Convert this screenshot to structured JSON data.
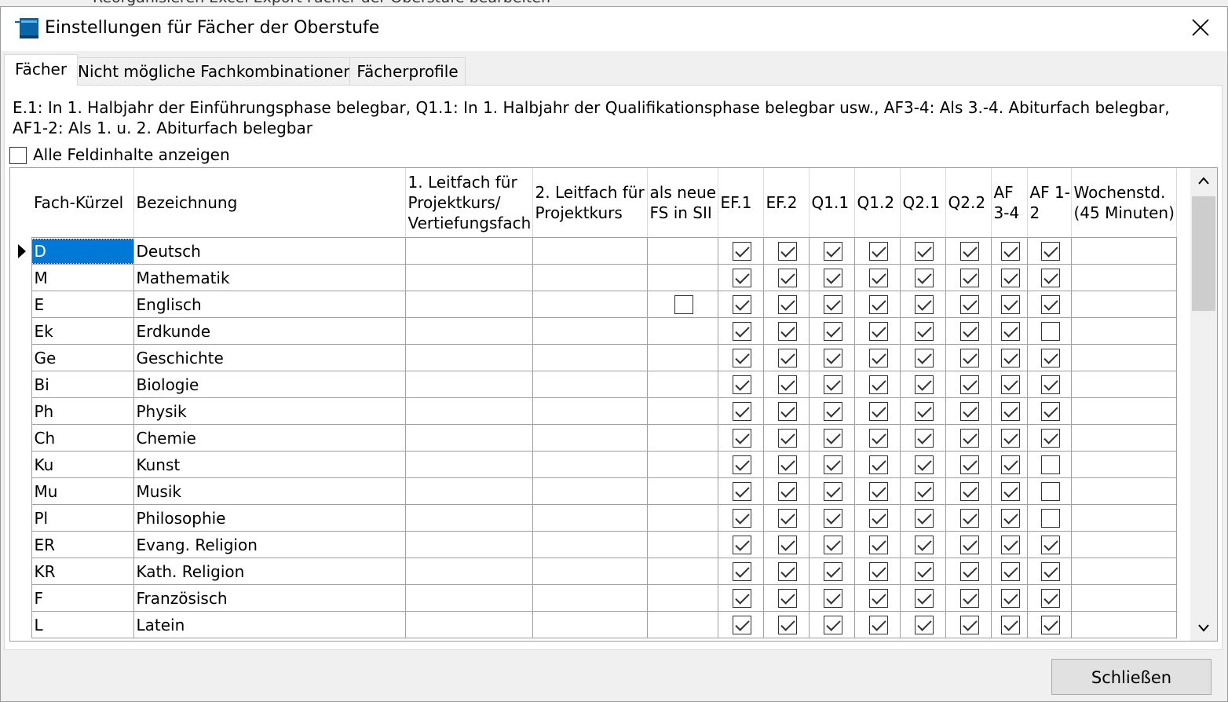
{
  "background_window": {
    "title_fragment": "Reorganisieren   Excel Export   Fächer der Oberstufe bearbeiten"
  },
  "window": {
    "title": "Einstellungen für Fächer der Oberstufe"
  },
  "tabs": [
    {
      "label": "Fächer",
      "active": true
    },
    {
      "label": "Nicht mögliche Fachkombinationen",
      "active": false
    },
    {
      "label": "Fächerprofile",
      "active": false
    }
  ],
  "description": "E.1: In 1. Halbjahr der Einführungsphase belegbar, Q1.1: In 1. Halbjahr der Qualifikationsphase belegbar usw., AF3-4: Als 3.-4. Abiturfach belegbar, AF1-2: Als 1. u. 2. Abiturfach belegbar",
  "show_all_checkbox": {
    "label": "Alle Feldinhalte anzeigen",
    "checked": false
  },
  "columns": {
    "kuerzel": "Fach-Kürzel",
    "bezeichnung": "Bezeichnung",
    "leitfach1": "1. Leitfach für Projektkurs/ Vertiefungsfach",
    "leitfach2": "2. Leitfach für Projektkurs",
    "neue_fs": "als neue FS in SII",
    "ef1": "EF.1",
    "ef2": "EF.2",
    "q11": "Q1.1",
    "q12": "Q1.2",
    "q21": "Q2.1",
    "q22": "Q2.2",
    "af34": "AF 3-4",
    "af12": "AF 1-2",
    "wochenstd": "Wochenstd. (45 Minuten)"
  },
  "rows": [
    {
      "kuerzel": "D",
      "bezeichnung": "Deutsch",
      "neue_fs": null,
      "ef1": true,
      "ef2": true,
      "q11": true,
      "q12": true,
      "q21": true,
      "q22": true,
      "af34": true,
      "af12": true,
      "selected": true
    },
    {
      "kuerzel": "M",
      "bezeichnung": "Mathematik",
      "neue_fs": null,
      "ef1": true,
      "ef2": true,
      "q11": true,
      "q12": true,
      "q21": true,
      "q22": true,
      "af34": true,
      "af12": true
    },
    {
      "kuerzel": "E",
      "bezeichnung": "Englisch",
      "neue_fs": false,
      "ef1": true,
      "ef2": true,
      "q11": true,
      "q12": true,
      "q21": true,
      "q22": true,
      "af34": true,
      "af12": true
    },
    {
      "kuerzel": "Ek",
      "bezeichnung": "Erdkunde",
      "neue_fs": null,
      "ef1": true,
      "ef2": true,
      "q11": true,
      "q12": true,
      "q21": true,
      "q22": true,
      "af34": true,
      "af12": false
    },
    {
      "kuerzel": "Ge",
      "bezeichnung": "Geschichte",
      "neue_fs": null,
      "ef1": true,
      "ef2": true,
      "q11": true,
      "q12": true,
      "q21": true,
      "q22": true,
      "af34": true,
      "af12": true
    },
    {
      "kuerzel": "Bi",
      "bezeichnung": "Biologie",
      "neue_fs": null,
      "ef1": true,
      "ef2": true,
      "q11": true,
      "q12": true,
      "q21": true,
      "q22": true,
      "af34": true,
      "af12": true
    },
    {
      "kuerzel": "Ph",
      "bezeichnung": "Physik",
      "neue_fs": null,
      "ef1": true,
      "ef2": true,
      "q11": true,
      "q12": true,
      "q21": true,
      "q22": true,
      "af34": true,
      "af12": true
    },
    {
      "kuerzel": "Ch",
      "bezeichnung": "Chemie",
      "neue_fs": null,
      "ef1": true,
      "ef2": true,
      "q11": true,
      "q12": true,
      "q21": true,
      "q22": true,
      "af34": true,
      "af12": true
    },
    {
      "kuerzel": "Ku",
      "bezeichnung": "Kunst",
      "neue_fs": null,
      "ef1": true,
      "ef2": true,
      "q11": true,
      "q12": true,
      "q21": true,
      "q22": true,
      "af34": true,
      "af12": false
    },
    {
      "kuerzel": "Mu",
      "bezeichnung": "Musik",
      "neue_fs": null,
      "ef1": true,
      "ef2": true,
      "q11": true,
      "q12": true,
      "q21": true,
      "q22": true,
      "af34": true,
      "af12": false
    },
    {
      "kuerzel": "Pl",
      "bezeichnung": "Philosophie",
      "neue_fs": null,
      "ef1": true,
      "ef2": true,
      "q11": true,
      "q12": true,
      "q21": true,
      "q22": true,
      "af34": true,
      "af12": false
    },
    {
      "kuerzel": "ER",
      "bezeichnung": "Evang. Religion",
      "neue_fs": null,
      "ef1": true,
      "ef2": true,
      "q11": true,
      "q12": true,
      "q21": true,
      "q22": true,
      "af34": true,
      "af12": true
    },
    {
      "kuerzel": "KR",
      "bezeichnung": "Kath. Religion",
      "neue_fs": null,
      "ef1": true,
      "ef2": true,
      "q11": true,
      "q12": true,
      "q21": true,
      "q22": true,
      "af34": true,
      "af12": true
    },
    {
      "kuerzel": "F",
      "bezeichnung": "Französisch",
      "neue_fs": null,
      "ef1": true,
      "ef2": true,
      "q11": true,
      "q12": true,
      "q21": true,
      "q22": true,
      "af34": true,
      "af12": true
    },
    {
      "kuerzel": "L",
      "bezeichnung": "Latein",
      "neue_fs": null,
      "ef1": true,
      "ef2": true,
      "q11": true,
      "q12": true,
      "q21": true,
      "q22": true,
      "af34": true,
      "af12": true
    }
  ],
  "footer": {
    "close_label": "Schließen"
  },
  "colors": {
    "selection": "#0078d7",
    "icon": "#0a64a8"
  },
  "icons": {
    "app": "window-app-icon",
    "close": "close-icon",
    "row_pointer": "row-pointer-icon",
    "scroll_up": "chevron-up-icon",
    "scroll_down": "chevron-down-icon"
  }
}
